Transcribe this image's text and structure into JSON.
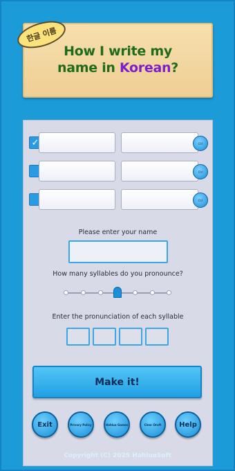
{
  "header": {
    "badge": "한글 이름",
    "title_line1": "How I write my",
    "title_line2_prefix": "name in ",
    "title_line2_highlight": "Korean",
    "title_line2_suffix": "?"
  },
  "rows": [
    {
      "checked": true,
      "check_glyph": "✓",
      "btn_label": "Ctrl"
    },
    {
      "checked": false,
      "check_glyph": "",
      "btn_label": "Ctrl"
    },
    {
      "checked": false,
      "check_glyph": "",
      "btn_label": "Ctrl"
    }
  ],
  "form": {
    "name_label": "Please enter your name",
    "name_value": "",
    "syllables_label": "How many syllables do you pronounce?",
    "syllable_count": 4,
    "syllable_ticks": 7,
    "pronunciation_label": "Enter the pronunciation of each syllable",
    "syllable_values": [
      "",
      "",
      "",
      ""
    ]
  },
  "make_button": "Make it!",
  "bottom_buttons": {
    "exit": "Exit",
    "privacy": "Privacy Policy",
    "games": "Hahlua Games",
    "clear": "Clear Draft",
    "help": "Help"
  },
  "footer": "Copyright (C) 2025 HahluaSoft",
  "colors": {
    "background": "#1b9bd8",
    "header_bg": "#f6dfae",
    "title_green": "#1f6b1b",
    "title_purple": "#7d1fc9",
    "accent_blue": "#22a0e4"
  }
}
